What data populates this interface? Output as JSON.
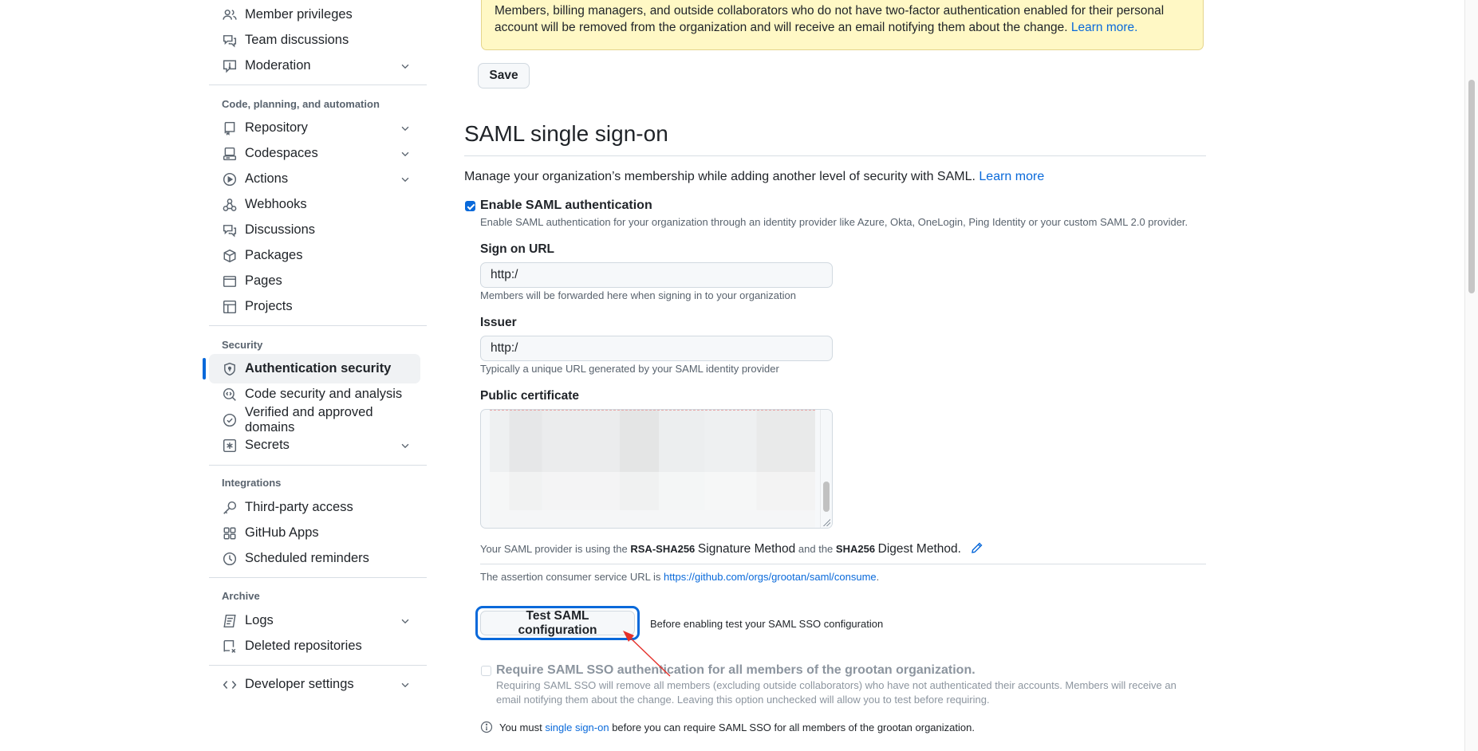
{
  "sidebar": {
    "items_top": [
      {
        "label": "Member privileges",
        "icon": "people-icon"
      },
      {
        "label": "Team discussions",
        "icon": "comment-discussion-icon"
      },
      {
        "label": "Moderation",
        "icon": "report-icon",
        "expandable": true
      }
    ],
    "sections": [
      {
        "heading": "Code, planning, and automation",
        "items": [
          {
            "label": "Repository",
            "icon": "repo-icon",
            "expandable": true
          },
          {
            "label": "Codespaces",
            "icon": "codespaces-icon",
            "expandable": true
          },
          {
            "label": "Actions",
            "icon": "play-icon",
            "expandable": true
          },
          {
            "label": "Webhooks",
            "icon": "webhook-icon"
          },
          {
            "label": "Discussions",
            "icon": "comment-discussion-icon"
          },
          {
            "label": "Packages",
            "icon": "package-icon"
          },
          {
            "label": "Pages",
            "icon": "browser-icon"
          },
          {
            "label": "Projects",
            "icon": "table-icon"
          }
        ]
      },
      {
        "heading": "Security",
        "items": [
          {
            "label": "Authentication security",
            "icon": "shield-lock-icon",
            "active": true
          },
          {
            "label": "Code security and analysis",
            "icon": "codescan-icon"
          },
          {
            "label": "Verified and approved domains",
            "icon": "verified-icon"
          },
          {
            "label": "Secrets",
            "icon": "key-asterisk-icon",
            "expandable": true
          }
        ]
      },
      {
        "heading": "Integrations",
        "items": [
          {
            "label": "Third-party access",
            "icon": "key-icon"
          },
          {
            "label": "GitHub Apps",
            "icon": "apps-icon"
          },
          {
            "label": "Scheduled reminders",
            "icon": "clock-icon"
          }
        ]
      },
      {
        "heading": "Archive",
        "items": [
          {
            "label": "Logs",
            "icon": "log-icon",
            "expandable": true
          },
          {
            "label": "Deleted repositories",
            "icon": "repo-deleted-icon"
          }
        ]
      }
    ],
    "developer_settings": {
      "label": "Developer settings",
      "icon": "code-icon",
      "expandable": true
    }
  },
  "two_factor": {
    "flash_text": "Members, billing managers, and outside collaborators who do not have two-factor authentication enabled for their personal account will be removed from the organization and will receive an email notifying them about the change.",
    "flash_link": "Learn more.",
    "save_label": "Save"
  },
  "saml": {
    "title": "SAML single sign-on",
    "description": "Manage your organization’s membership while adding another level of security with SAML.",
    "description_link": "Learn more",
    "enable": {
      "label": "Enable SAML authentication",
      "checked": true,
      "note": "Enable SAML authentication for your organization through an identity provider like Azure, Okta, OneLogin, Ping Identity or your custom SAML 2.0 provider."
    },
    "sign_on_url": {
      "label": "Sign on URL",
      "value": "http:/",
      "note": "Members will be forwarded here when signing in to your organization"
    },
    "issuer": {
      "label": "Issuer",
      "value": "http:/",
      "note": "Typically a unique URL generated by your SAML identity provider"
    },
    "public_certificate": {
      "label": "Public certificate",
      "value": "(redacted)"
    },
    "signature": {
      "prefix": "Your SAML provider is using the",
      "signature_method": "RSA-SHA256",
      "signature_label": "Signature Method",
      "middle": "and the",
      "digest_method": "SHA256",
      "digest_label": "Digest Method."
    },
    "acs": {
      "prefix": "The assertion consumer service URL is",
      "url": "https://github.com/orgs/grootan/saml/consume",
      "suffix": "."
    },
    "test_button": "Test SAML configuration",
    "test_hint": "Before enabling test your SAML SSO configuration",
    "require": {
      "label": "Require SAML SSO authentication for all members of the grootan organization.",
      "checked": false,
      "disabled": true,
      "note": "Requiring SAML SSO will remove all members (excluding outside collaborators) who have not authenticated their accounts. Members will receive an email notifying them about the change. Leaving this option unchecked will allow you to test before requiring."
    },
    "info": {
      "prefix": "You must",
      "link": "single sign-on",
      "suffix": "before you can require SAML SSO for all members of the grootan organization."
    }
  },
  "colors": {
    "accent": "#0969da",
    "flash_bg": "#fff8c5",
    "annotation_arrow": "#e5302a"
  }
}
